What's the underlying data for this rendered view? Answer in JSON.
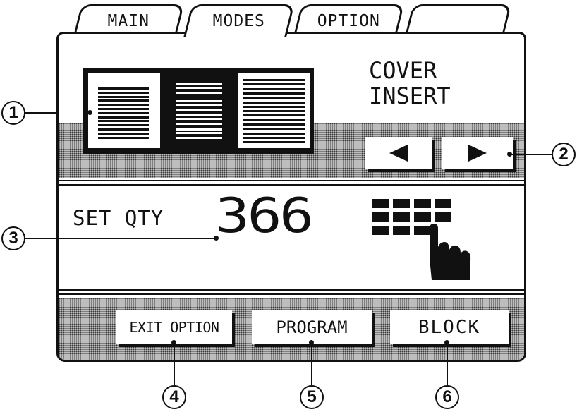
{
  "tabs": [
    {
      "label": "MAIN",
      "active": false
    },
    {
      "label": "MODES",
      "active": true
    },
    {
      "label": "OPTION",
      "active": false
    },
    {
      "label": "",
      "active": false
    }
  ],
  "mode_label": {
    "line1": "COVER",
    "line2": "INSERT"
  },
  "nav": {
    "prev_icon": "triangle-left",
    "next_icon": "triangle-right"
  },
  "quantity": {
    "label": "SET QTY",
    "value": "366"
  },
  "keypad_icon": "keypad-hand",
  "buttons": {
    "exit_option": "EXIT OPTION",
    "program": "PROGRAM",
    "block": "BLOCK"
  },
  "callouts": [
    "1",
    "2",
    "3",
    "4",
    "5",
    "6"
  ],
  "colors": {
    "ink": "#111111",
    "dither": "#c4c4c4",
    "background": "#ffffff"
  }
}
